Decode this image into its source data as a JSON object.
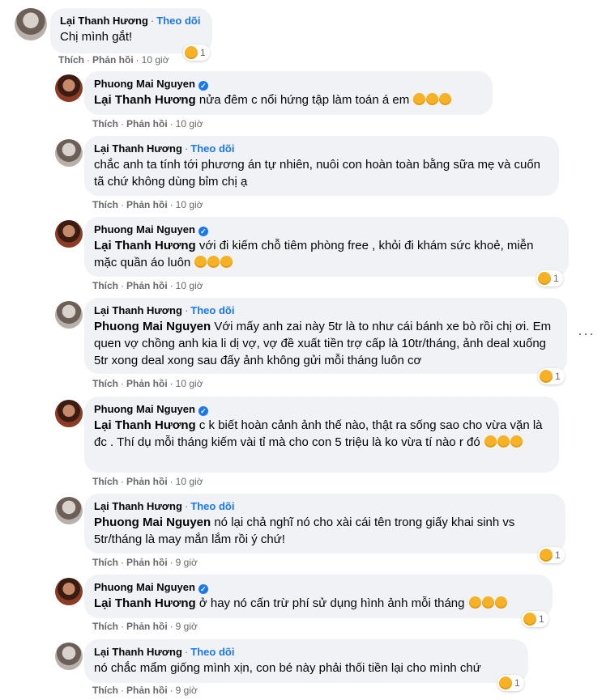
{
  "labels": {
    "like": "Thích",
    "reply": "Phản hồi",
    "follow": "Theo dõi",
    "more": "···"
  },
  "comments": [
    {
      "author": "Lại Thanh Hương",
      "follow": true,
      "mention": "",
      "text": "Chị mình gắt!",
      "emoji_count": 0,
      "time": "10 giờ",
      "reaction": "1"
    },
    {
      "author": "Phuong Mai Nguyen",
      "verified": true,
      "mention": "Lại Thanh Hương",
      "text": " nửa đêm c nổi hứng tập làm toán á em",
      "emoji_count": 3,
      "time": "10 giờ",
      "reaction": ""
    },
    {
      "author": "Lại Thanh Hương",
      "follow": true,
      "mention": "",
      "text": "chắc anh ta tính tới phương án tự nhiên, nuôi con hoàn toàn bằng sữa mẹ và cuốn tã chứ không dùng bỉm chị ạ",
      "emoji_count": 0,
      "time": "10 giờ",
      "reaction": ""
    },
    {
      "author": "Phuong Mai Nguyen",
      "verified": true,
      "mention": "Lại Thanh Hương",
      "text": " với đi kiếm chỗ tiêm phòng free , khỏi đi khám sức khoẻ, miễn mặc quần áo luôn",
      "emoji_count": 3,
      "time": "10 giờ",
      "reaction": "1"
    },
    {
      "author": "Lại Thanh Hương",
      "follow": true,
      "mention": "Phuong Mai Nguyen",
      "text": " Với mấy anh zai này 5tr là to như cái bánh xe bò rồi chị ơi. Em quen vợ chồng anh kia li dị vợ, vợ đề xuất tiền trợ cấp là 10tr/tháng, ảnh deal xuống 5tr xong deal xong sau đấy ảnh không gửi mỗi tháng luôn cơ",
      "emoji_count": 0,
      "time": "10 giờ",
      "reaction": "1"
    },
    {
      "author": "Phuong Mai Nguyen",
      "verified": true,
      "mention": "Lại Thanh Hương",
      "text": " c k biết hoàn cảnh ảnh thế nào, thật ra sống sao cho vừa vặn là đc . Thí dụ mỗi tháng kiếm vài tỉ mà cho con 5 triệu là ko vừa tí nào r đó",
      "emoji_count": 3,
      "time": "10 giờ",
      "reaction": ""
    },
    {
      "author": "Lại Thanh Hương",
      "follow": true,
      "mention": "Phuong Mai Nguyen",
      "text": " nó lại chả nghĩ nó cho xài cái tên trong giấy khai sinh vs 5tr/tháng là may mắn lắm rồi ý chứ!",
      "emoji_count": 0,
      "time": "9 giờ",
      "reaction": "1"
    },
    {
      "author": "Phuong Mai Nguyen",
      "verified": true,
      "mention": "Lại Thanh Hương",
      "text": " ở hay nó cấn trừ phí sử dụng hình ảnh mỗi tháng",
      "emoji_count": 3,
      "time": "9 giờ",
      "reaction": "1"
    },
    {
      "author": "Lại Thanh Hương",
      "follow": true,
      "mention": "",
      "text": "nó chắc mẩm giống mình xịn, con bé này phải thối tiền lại cho mình chứ",
      "emoji_count": 0,
      "time": "9 giờ",
      "reaction": "1"
    }
  ]
}
